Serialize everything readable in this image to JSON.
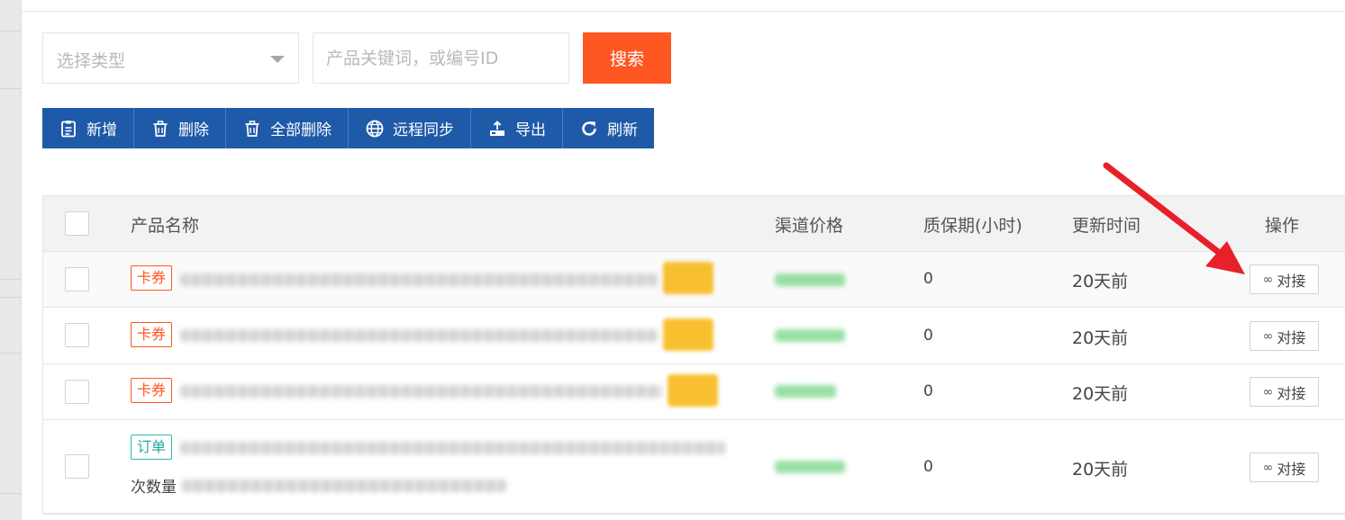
{
  "search": {
    "type_placeholder": "选择类型",
    "keyword_placeholder": "产品关键词，或编号ID",
    "search_label": "搜索"
  },
  "toolbar": {
    "add": "新增",
    "delete": "删除",
    "delete_all": "全部删除",
    "remote_sync": "远程同步",
    "export": "导出",
    "refresh": "刷新"
  },
  "table": {
    "headers": {
      "name": "产品名称",
      "price": "渠道价格",
      "warranty": "质保期(小时)",
      "updated": "更新时间",
      "actions": "操作"
    },
    "rows": [
      {
        "tag": "卡券",
        "name_suffix": "",
        "warranty": "0",
        "updated": "20天前",
        "action": "对接"
      },
      {
        "tag": "卡券",
        "name_suffix": "",
        "warranty": "0",
        "updated": "20天前",
        "action": "对接"
      },
      {
        "tag": "卡券",
        "name_suffix": "",
        "warranty": "0",
        "updated": "20天前",
        "action": "对接"
      },
      {
        "tag": "订单",
        "name_suffix": "次数量",
        "warranty": "0",
        "updated": "20天前",
        "action": "对接"
      }
    ]
  },
  "colors": {
    "primary": "#1e5aa8",
    "accent": "#ff5722",
    "annotation_arrow": "#e8202a"
  }
}
